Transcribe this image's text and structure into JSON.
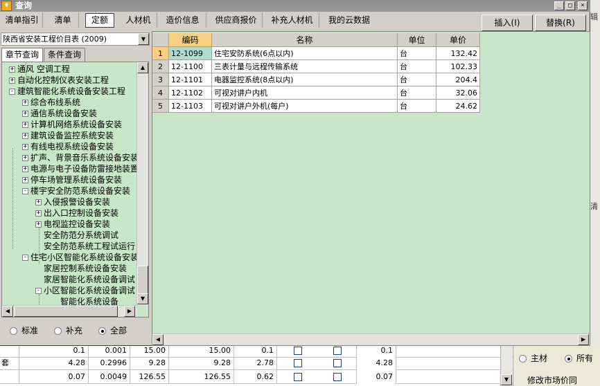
{
  "window": {
    "title": "查询"
  },
  "tabs": [
    "清单指引",
    "清单",
    "定额",
    "人材机",
    "造价信息",
    "供应商报价",
    "补充人材机",
    "我的云数据"
  ],
  "active_tab": 2,
  "actions": {
    "insert": "插入(I)",
    "replace": "替换(R)"
  },
  "left": {
    "catalog": "陕西省安装工程价目表 (2009)",
    "subtabs": [
      "章节查询",
      "条件查询"
    ],
    "tree": [
      {
        "label": "通风 空调工程",
        "level": 0,
        "expand": "+"
      },
      {
        "label": "自动化控制仪表安装工程",
        "level": 0,
        "expand": "+"
      },
      {
        "label": "建筑智能化系统设备安装工程",
        "level": 0,
        "expand": "-"
      },
      {
        "label": "综合布线系统",
        "level": 1,
        "expand": "+"
      },
      {
        "label": "通信系统设备安装",
        "level": 1,
        "expand": "+"
      },
      {
        "label": "计算机网络系统设备安装",
        "level": 1,
        "expand": "+"
      },
      {
        "label": "建筑设备监控系统安装",
        "level": 1,
        "expand": "+"
      },
      {
        "label": "有线电视系统设备安装",
        "level": 1,
        "expand": "+"
      },
      {
        "label": "扩声、背景音乐系统设备安装",
        "level": 1,
        "expand": "+"
      },
      {
        "label": "电源与电子设备防雷接地装置",
        "level": 1,
        "expand": "+"
      },
      {
        "label": "停车场管理系统设备安装",
        "level": 1,
        "expand": "+"
      },
      {
        "label": "楼宇安全防范系统设备安装",
        "level": 1,
        "expand": "-"
      },
      {
        "label": "入侵报警设备安装",
        "level": 2,
        "expand": "+"
      },
      {
        "label": "出入口控制设备安装",
        "level": 2,
        "expand": "+"
      },
      {
        "label": "电视监控设备安装",
        "level": 2,
        "expand": "+"
      },
      {
        "label": "安全防范分系统调试",
        "level": 2,
        "expand": ""
      },
      {
        "label": "安全防范系统工程试运行",
        "level": 2,
        "expand": ""
      },
      {
        "label": "住宅小区智能化系统设备安装",
        "level": 1,
        "expand": "-"
      },
      {
        "label": "家居控制系统设备安装",
        "level": 2,
        "expand": ""
      },
      {
        "label": "家居智能化系统设备调试",
        "level": 2,
        "expand": ""
      },
      {
        "label": "小区智能化系统设备调试",
        "level": 2,
        "expand": "-"
      },
      {
        "label": "智能化系统设备",
        "level": 3,
        "expand": ""
      }
    ],
    "filters": [
      "标准",
      "补充",
      "全部"
    ],
    "filter_selected": 2
  },
  "table": {
    "columns": [
      "编码",
      "名称",
      "单位",
      "单价"
    ],
    "rows": [
      {
        "idx": "1",
        "code": "12-1099",
        "name": "住宅安防系统(6点以内)",
        "unit": "台",
        "price": "132.42"
      },
      {
        "idx": "2",
        "code": "12-1100",
        "name": "三表计量与远程传输系统",
        "unit": "台",
        "price": "102.33"
      },
      {
        "idx": "3",
        "code": "12-1101",
        "name": "电器监控系统(8点以内)",
        "unit": "台",
        "price": "204.4"
      },
      {
        "idx": "4",
        "code": "12-1102",
        "name": "可视对讲户内机",
        "unit": "台",
        "price": "32.06"
      },
      {
        "idx": "5",
        "code": "12-1103",
        "name": "可视对讲户外机(每户)",
        "unit": "台",
        "price": "24.62"
      }
    ]
  },
  "background": {
    "rows": [
      {
        "label": "",
        "c1": "0.1",
        "c2": "0.001",
        "c3": "15.00",
        "c4": "15.00",
        "c5": "0.1",
        "c6": "0.1"
      },
      {
        "label": "套",
        "c1": "4.28",
        "c2": "0.2996",
        "c3": "9.28",
        "c4": "9.28",
        "c5": "2.78",
        "c6": "4.28"
      },
      {
        "label": "",
        "c1": "0.07",
        "c2": "0.0049",
        "c3": "126.55",
        "c4": "126.55",
        "c5": "0.62",
        "c6": "0.07"
      }
    ],
    "radio_main": "主材",
    "radio_all": "所有",
    "cut_label": "修改市场价同",
    "side_a": "辑",
    "side_b": "清"
  }
}
